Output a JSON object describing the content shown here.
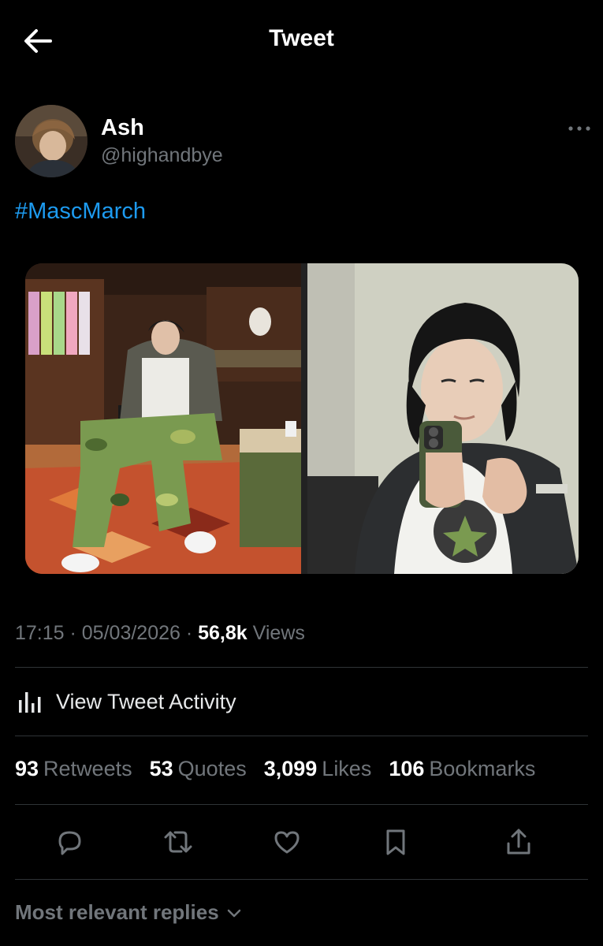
{
  "header": {
    "title": "Tweet",
    "back_icon": "arrow-left-icon"
  },
  "author": {
    "name": "Ash",
    "handle": "@highandbye",
    "more_icon": "ellipsis-icon"
  },
  "tweet": {
    "text": "#MascMarch",
    "hashtag_color": "#1d9bf0",
    "media": [
      {
        "description_icon": "photo-store-seated"
      },
      {
        "description_icon": "photo-mirror-selfie"
      }
    ]
  },
  "meta": {
    "time": "17:15",
    "date": "05/03/2026",
    "views_count": "56,8k",
    "views_label": "Views"
  },
  "activity": {
    "label": "View Tweet Activity",
    "icon": "bar-chart-icon"
  },
  "stats": [
    {
      "count": "93",
      "label": "Retweets"
    },
    {
      "count": "53",
      "label": "Quotes"
    },
    {
      "count": "3,099",
      "label": "Likes"
    },
    {
      "count": "106",
      "label": "Bookmarks"
    }
  ],
  "actions": [
    "reply-icon",
    "retweet-icon",
    "like-icon",
    "bookmark-icon",
    "share-icon"
  ],
  "replies": {
    "label": "Most relevant replies",
    "icon": "chevron-down-icon"
  },
  "colors": {
    "background": "#000000",
    "muted": "#71767b",
    "divider": "#2f3336",
    "accent": "#1d9bf0"
  }
}
